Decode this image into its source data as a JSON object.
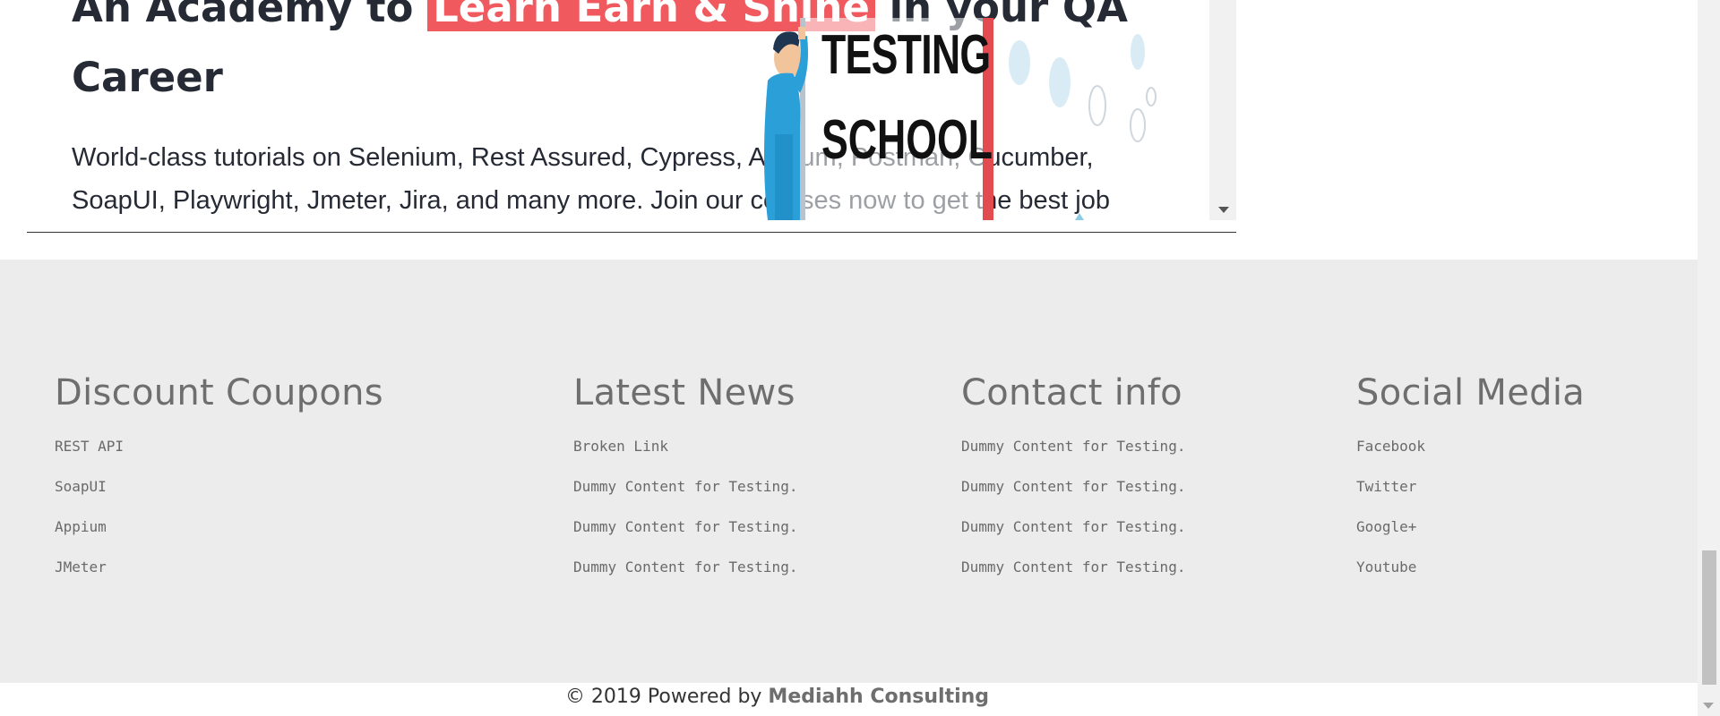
{
  "hero": {
    "heading_prefix": "An Academy to ",
    "heading_highlight": "Learn Earn & Shine",
    "heading_suffix": "  in your QA Career",
    "description": "World-class tutorials on Selenium, Rest Assured, Cypress, Appium, Postman, Cucumber, SoapUI, Playwright, Jmeter, Jira, and many more. Join our courses now to get the best job",
    "image_text_line1": "TESTING",
    "image_text_line2": "SCHOOL"
  },
  "footer": {
    "columns": [
      {
        "title": "Discount Coupons",
        "links": [
          "REST API",
          "SoapUI",
          "Appium",
          "JMeter"
        ]
      },
      {
        "title": "Latest News",
        "links": [
          "Broken Link",
          "Dummy Content for Testing.",
          "Dummy Content for Testing.",
          "Dummy Content for Testing."
        ]
      },
      {
        "title": "Contact info",
        "links": [
          "Dummy Content for Testing.",
          "Dummy Content for Testing.",
          "Dummy Content for Testing.",
          "Dummy Content for Testing."
        ]
      },
      {
        "title": "Social Media",
        "links": [
          "Facebook",
          "Twitter",
          "Google+",
          "Youtube"
        ]
      }
    ]
  },
  "copyright": {
    "text": "© 2019 Powered by ",
    "link_label": "Mediahh Consulting"
  },
  "colors": {
    "highlight": "#f05a5f",
    "footer_bg": "#ececec",
    "heading_text": "#252a34"
  }
}
